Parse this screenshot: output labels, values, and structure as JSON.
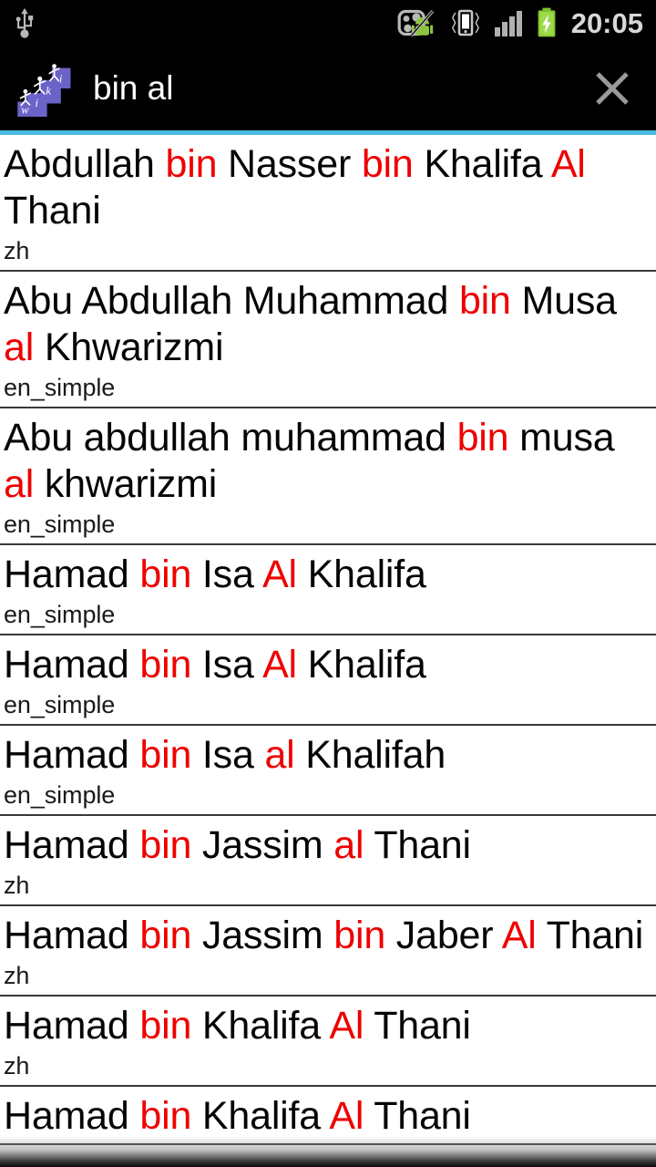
{
  "status_bar": {
    "usb_icon": "usb-icon",
    "sync_disabled_icon": "sync-disabled-icon",
    "vibrate_icon": "vibrate-icon",
    "signal_icon": "signal-bars-icon",
    "battery_icon": "battery-charging-icon",
    "time": "20:05",
    "background_color": "#000000",
    "text_color": "#d8d8d8"
  },
  "action_bar": {
    "logo_icon": "wiki-logo-icon",
    "logo_colors": {
      "block": "#6c63c8",
      "figure": "#ffffff",
      "letter": "#ffffff"
    },
    "query": "bin al",
    "close_icon": "close-x-icon",
    "background_color": "#000000",
    "accent_color": "#4eb9e0"
  },
  "list": {
    "highlight_color": "#ee0000",
    "divider_color": "#383838",
    "items": [
      {
        "title_parts": [
          {
            "text": "Abdullah ",
            "highlight": false
          },
          {
            "text": "bin",
            "highlight": true
          },
          {
            "text": " Nasser ",
            "highlight": false
          },
          {
            "text": "bin",
            "highlight": true
          },
          {
            "text": " Khalifa ",
            "highlight": false
          },
          {
            "text": "Al",
            "highlight": true
          },
          {
            "text": " Thani",
            "highlight": false
          }
        ],
        "title_plain": "Abdullah bin Nasser bin Khalifa Al Thani",
        "lang": "zh"
      },
      {
        "title_parts": [
          {
            "text": "Abu Abdullah Muhammad ",
            "highlight": false
          },
          {
            "text": "bin",
            "highlight": true
          },
          {
            "text": " Musa ",
            "highlight": false
          },
          {
            "text": "al",
            "highlight": true
          },
          {
            "text": " Khwarizmi",
            "highlight": false
          }
        ],
        "title_plain": "Abu Abdullah Muhammad bin Musa al Khwarizmi",
        "lang": "en_simple"
      },
      {
        "title_parts": [
          {
            "text": "Abu abdullah muhammad ",
            "highlight": false
          },
          {
            "text": "bin",
            "highlight": true
          },
          {
            "text": " musa ",
            "highlight": false
          },
          {
            "text": "al",
            "highlight": true
          },
          {
            "text": " khwarizmi",
            "highlight": false
          }
        ],
        "title_plain": "Abu abdullah muhammad bin musa al khwarizmi",
        "lang": "en_simple"
      },
      {
        "title_parts": [
          {
            "text": "Hamad ",
            "highlight": false
          },
          {
            "text": "bin",
            "highlight": true
          },
          {
            "text": " Isa ",
            "highlight": false
          },
          {
            "text": "Al",
            "highlight": true
          },
          {
            "text": " Khalifa",
            "highlight": false
          }
        ],
        "title_plain": "Hamad bin Isa Al Khalifa",
        "lang": "en_simple"
      },
      {
        "title_parts": [
          {
            "text": "Hamad ",
            "highlight": false
          },
          {
            "text": "bin",
            "highlight": true
          },
          {
            "text": " Isa ",
            "highlight": false
          },
          {
            "text": "Al",
            "highlight": true
          },
          {
            "text": " Khalifa",
            "highlight": false
          }
        ],
        "title_plain": "Hamad bin Isa Al Khalifa",
        "lang": "en_simple"
      },
      {
        "title_parts": [
          {
            "text": "Hamad ",
            "highlight": false
          },
          {
            "text": "bin",
            "highlight": true
          },
          {
            "text": " Isa ",
            "highlight": false
          },
          {
            "text": "al",
            "highlight": true
          },
          {
            "text": " Khalifah",
            "highlight": false
          }
        ],
        "title_plain": "Hamad bin Isa al Khalifah",
        "lang": "en_simple"
      },
      {
        "title_parts": [
          {
            "text": "Hamad ",
            "highlight": false
          },
          {
            "text": "bin",
            "highlight": true
          },
          {
            "text": " Jassim ",
            "highlight": false
          },
          {
            "text": "al",
            "highlight": true
          },
          {
            "text": " Thani",
            "highlight": false
          }
        ],
        "title_plain": "Hamad bin Jassim al Thani",
        "lang": "zh"
      },
      {
        "title_parts": [
          {
            "text": "Hamad ",
            "highlight": false
          },
          {
            "text": "bin",
            "highlight": true
          },
          {
            "text": " Jassim ",
            "highlight": false
          },
          {
            "text": "bin",
            "highlight": true
          },
          {
            "text": " Jaber ",
            "highlight": false
          },
          {
            "text": "Al",
            "highlight": true
          },
          {
            "text": " Thani",
            "highlight": false
          }
        ],
        "title_plain": "Hamad bin Jassim bin Jaber Al Thani",
        "lang": "zh"
      },
      {
        "title_parts": [
          {
            "text": "Hamad ",
            "highlight": false
          },
          {
            "text": "bin",
            "highlight": true
          },
          {
            "text": " Khalifa ",
            "highlight": false
          },
          {
            "text": "Al",
            "highlight": true
          },
          {
            "text": " Thani",
            "highlight": false
          }
        ],
        "title_plain": "Hamad bin Khalifa Al Thani",
        "lang": "zh"
      },
      {
        "title_parts": [
          {
            "text": "Hamad ",
            "highlight": false
          },
          {
            "text": "bin",
            "highlight": true
          },
          {
            "text": " Khalifa ",
            "highlight": false
          },
          {
            "text": "Al",
            "highlight": true
          },
          {
            "text": " Thani",
            "highlight": false
          }
        ],
        "title_plain": "Hamad bin Khalifa Al Thani",
        "lang": ""
      }
    ]
  }
}
